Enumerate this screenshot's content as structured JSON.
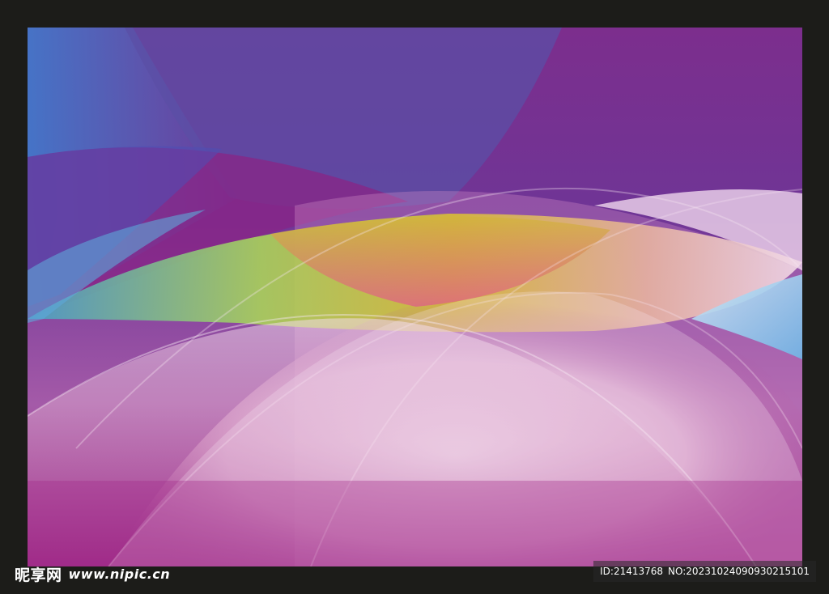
{
  "image": {
    "subject": "abstract",
    "colors": {
      "frame": "#1c1c19",
      "top_purple": "#7a2e8c",
      "blue": "#3f6fc4",
      "magenta": "#8b1f7e",
      "yellow": "#d8c33a",
      "pink_white": "#f4e6f0",
      "deep_magenta": "#9a2a82"
    }
  },
  "watermark": {
    "brand": "昵享网",
    "url": "www.nipic.cn",
    "id_label": "ID:21413768",
    "no_label": "NO:20231024090930215101"
  }
}
